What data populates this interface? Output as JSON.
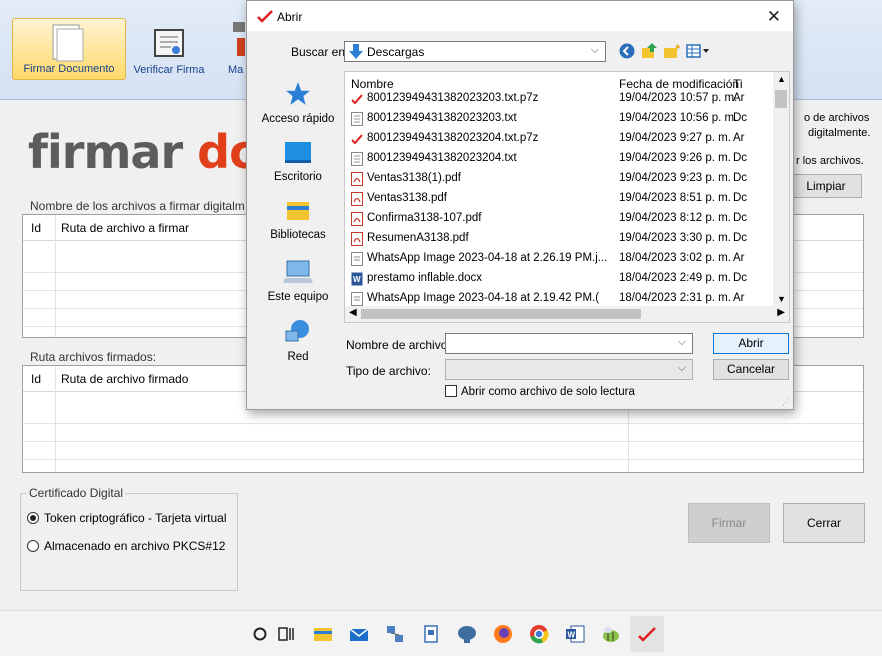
{
  "app": {
    "ribbon": {
      "buttons": [
        {
          "label": "Firmar Documento"
        },
        {
          "label": "Verificar Firma"
        },
        {
          "label": "Ma"
        }
      ]
    },
    "logo": {
      "part1": "firmar ",
      "part2": "dc"
    },
    "right_texts": {
      "line1": "o de archivos",
      "line2": "digitalmente.",
      "line3": "r los archivos.",
      "clear_button": "Limpiar"
    },
    "files_to_sign": {
      "title": "Nombre de los archivos a firmar digitalm",
      "col_id": "Id",
      "col_path": "Ruta de archivo a firmar"
    },
    "signed_files": {
      "title": "Ruta archivos firmados:",
      "col_id": "Id",
      "col_path": "Ruta de archivo firmado"
    },
    "certificate": {
      "title": "Certificado Digital",
      "options": [
        {
          "label": "Token criptográfico - Tarjeta virtual",
          "selected": true
        },
        {
          "label": "Almacenado en archivo PKCS#12",
          "selected": false
        }
      ]
    },
    "sign_button": "Firmar",
    "close_button": "Cerrar"
  },
  "dialog": {
    "title": "Abrir",
    "look_in_label": "Buscar en:",
    "look_in_value": "Descargas",
    "places": [
      {
        "label": "Acceso rápido",
        "icon": "star-icon"
      },
      {
        "label": "Escritorio",
        "icon": "desktop-icon"
      },
      {
        "label": "Bibliotecas",
        "icon": "libraries-icon"
      },
      {
        "label": "Este equipo",
        "icon": "computer-icon"
      },
      {
        "label": "Red",
        "icon": "network-icon"
      }
    ],
    "columns": {
      "name": "Nombre",
      "date": "Fecha de modificación",
      "type": "Ti"
    },
    "files": [
      {
        "name": "800123949431382023203.txt.p7z",
        "date": "19/04/2023 10:57 p. m.",
        "type": "Ar",
        "icon": "signed"
      },
      {
        "name": "800123949431382023203.txt",
        "date": "19/04/2023 10:56 p. m.",
        "type": "Dc",
        "icon": "txt"
      },
      {
        "name": "800123949431382023204.txt.p7z",
        "date": "19/04/2023 9:27 p. m.",
        "type": "Ar",
        "icon": "signed"
      },
      {
        "name": "800123949431382023204.txt",
        "date": "19/04/2023 9:26 p. m.",
        "type": "Dc",
        "icon": "txt"
      },
      {
        "name": "Ventas3138(1).pdf",
        "date": "19/04/2023 9:23 p. m.",
        "type": "Dc",
        "icon": "pdf"
      },
      {
        "name": "Ventas3138.pdf",
        "date": "19/04/2023 8:51 p. m.",
        "type": "Dc",
        "icon": "pdf"
      },
      {
        "name": "Confirma3138-107.pdf",
        "date": "19/04/2023 8:12 p. m.",
        "type": "Dc",
        "icon": "pdf"
      },
      {
        "name": "ResumenA3138.pdf",
        "date": "19/04/2023 3:30 p. m.",
        "type": "Dc",
        "icon": "pdf"
      },
      {
        "name": "WhatsApp Image 2023-04-18 at 2.26.19 PM.j...",
        "date": "18/04/2023 3:02 p. m.",
        "type": "Ar",
        "icon": "image"
      },
      {
        "name": "prestamo inflable.docx",
        "date": "18/04/2023 2:49 p. m.",
        "type": "Dc",
        "icon": "word"
      },
      {
        "name": "WhatsApp Image 2023-04-18 at 2.19.42 PM.(",
        "date": "18/04/2023 2:31 p. m.",
        "type": "Ar",
        "icon": "image"
      }
    ],
    "file_name_label": "Nombre de archivo:",
    "file_name_value": "",
    "file_type_label": "Tipo de archivo:",
    "file_type_value": "",
    "readonly_label": "Abrir como archivo de solo lectura",
    "open_button": "Abrir",
    "cancel_button": "Cancelar"
  }
}
